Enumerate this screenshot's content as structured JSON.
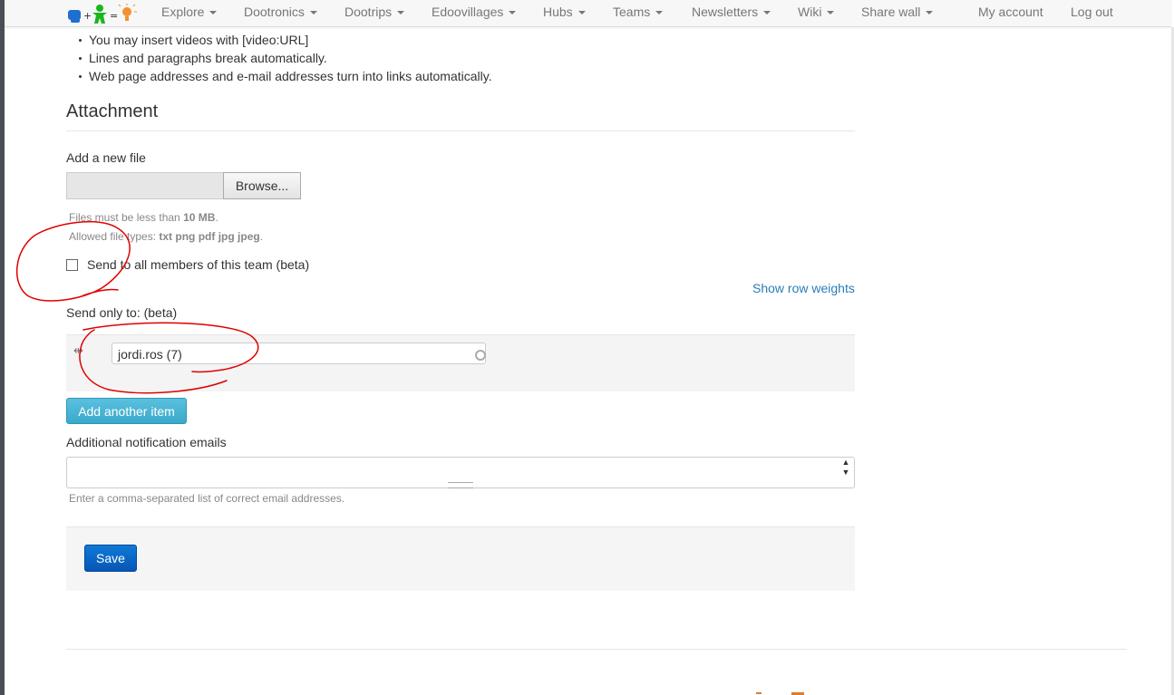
{
  "navbar": {
    "items": [
      {
        "label": "Explore",
        "dropdown": true
      },
      {
        "label": "Dootronics",
        "dropdown": true
      },
      {
        "label": "Dootrips",
        "dropdown": true
      },
      {
        "label": "Edoovillages",
        "dropdown": true
      },
      {
        "label": "Hubs",
        "dropdown": true
      },
      {
        "label": "Teams",
        "dropdown": true
      },
      {
        "label": "Newsletters",
        "dropdown": true
      },
      {
        "label": "Wiki",
        "dropdown": true
      },
      {
        "label": "Share wall",
        "dropdown": true
      },
      {
        "label": "My account",
        "dropdown": false
      },
      {
        "label": "Log out",
        "dropdown": false
      }
    ]
  },
  "format_tips": [
    "You may insert videos with [video:URL]",
    "Lines and paragraphs break automatically.",
    "Web page addresses and e-mail addresses turn into links automatically."
  ],
  "attachment": {
    "heading": "Attachment",
    "add_file_label": "Add a new file",
    "browse_label": "Browse...",
    "size_help_prefix": "Files must be less than ",
    "size_help_value": "10 MB",
    "size_help_suffix": ".",
    "types_help_prefix": "Allowed file types: ",
    "types_help_value": "txt png pdf jpg jpeg",
    "types_help_suffix": "."
  },
  "send_all": {
    "label": "Send to all members of this team (beta)",
    "checked": false
  },
  "show_row_weights": "Show row weights",
  "send_only": {
    "label": "Send only to: (beta)",
    "recipients": [
      "jordi.ros (7)"
    ],
    "add_another_label": "Add another item"
  },
  "notification_emails": {
    "label": "Additional notification emails",
    "value": "",
    "help": "Enter a comma-separated list of correct email addresses."
  },
  "save_label": "Save",
  "colors": {
    "link": "#2a7db8",
    "info_button": "#5bc0de",
    "primary_button": "#0756b5",
    "annotation": "#e00000"
  }
}
